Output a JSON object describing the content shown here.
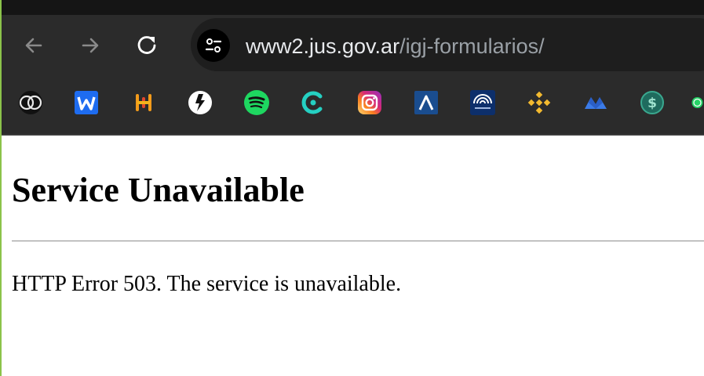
{
  "browser": {
    "address_bar": {
      "url_host": "www2.jus.gov.ar",
      "url_path": "/igj-formularios/"
    },
    "nav": {
      "back_icon": "arrow-left-icon",
      "forward_icon": "arrow-right-icon",
      "reload_icon": "reload-icon",
      "site_info_icon": "tune-icon"
    },
    "bookmarks": [
      {
        "name": "bookmark-coin-logo",
        "icon": "coin-logo-icon"
      },
      {
        "name": "bookmark-w",
        "icon": "w-letter-icon"
      },
      {
        "name": "bookmark-h-bars",
        "icon": "h-bars-icon"
      },
      {
        "name": "bookmark-circle-logo",
        "icon": "circle-logo-icon"
      },
      {
        "name": "bookmark-spotify",
        "icon": "spotify-icon"
      },
      {
        "name": "bookmark-c-logo",
        "icon": "c-logo-icon"
      },
      {
        "name": "bookmark-instagram",
        "icon": "instagram-icon"
      },
      {
        "name": "bookmark-a-logo",
        "icon": "a-logo-icon"
      },
      {
        "name": "bookmark-bank",
        "icon": "bank-logo-icon"
      },
      {
        "name": "bookmark-binance",
        "icon": "binance-icon"
      },
      {
        "name": "bookmark-m-logo",
        "icon": "m-logo-icon"
      },
      {
        "name": "bookmark-dollar",
        "icon": "dollar-icon"
      },
      {
        "name": "bookmark-whatsapp",
        "icon": "whatsapp-icon"
      }
    ]
  },
  "page": {
    "heading": "Service Unavailable",
    "message": "HTTP Error 503. The service is unavailable."
  },
  "colors": {
    "toolbar_bg": "#2b2b2b",
    "omnibox_bg": "#1e1e1e",
    "spotify": "#1ed760",
    "binance": "#f3ba2f"
  }
}
